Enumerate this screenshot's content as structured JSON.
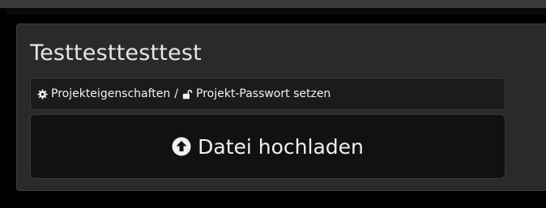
{
  "project": {
    "title": "Testtesttesttest"
  },
  "breadcrumb": {
    "items": [
      {
        "label": "Projekteigenschaften",
        "icon": "gear-icon"
      },
      {
        "label": "Projekt-Passwort setzen",
        "icon": "unlock-icon"
      }
    ],
    "separator": "/"
  },
  "upload": {
    "label": "Datei hochladen",
    "icon": "upload-circle-icon"
  },
  "colors": {
    "background": "#000000",
    "panel": "#2a2a2a",
    "breadcrumb_bg": "#1b1b1b",
    "button_bg": "#111111",
    "text": "#f0f0f0"
  }
}
